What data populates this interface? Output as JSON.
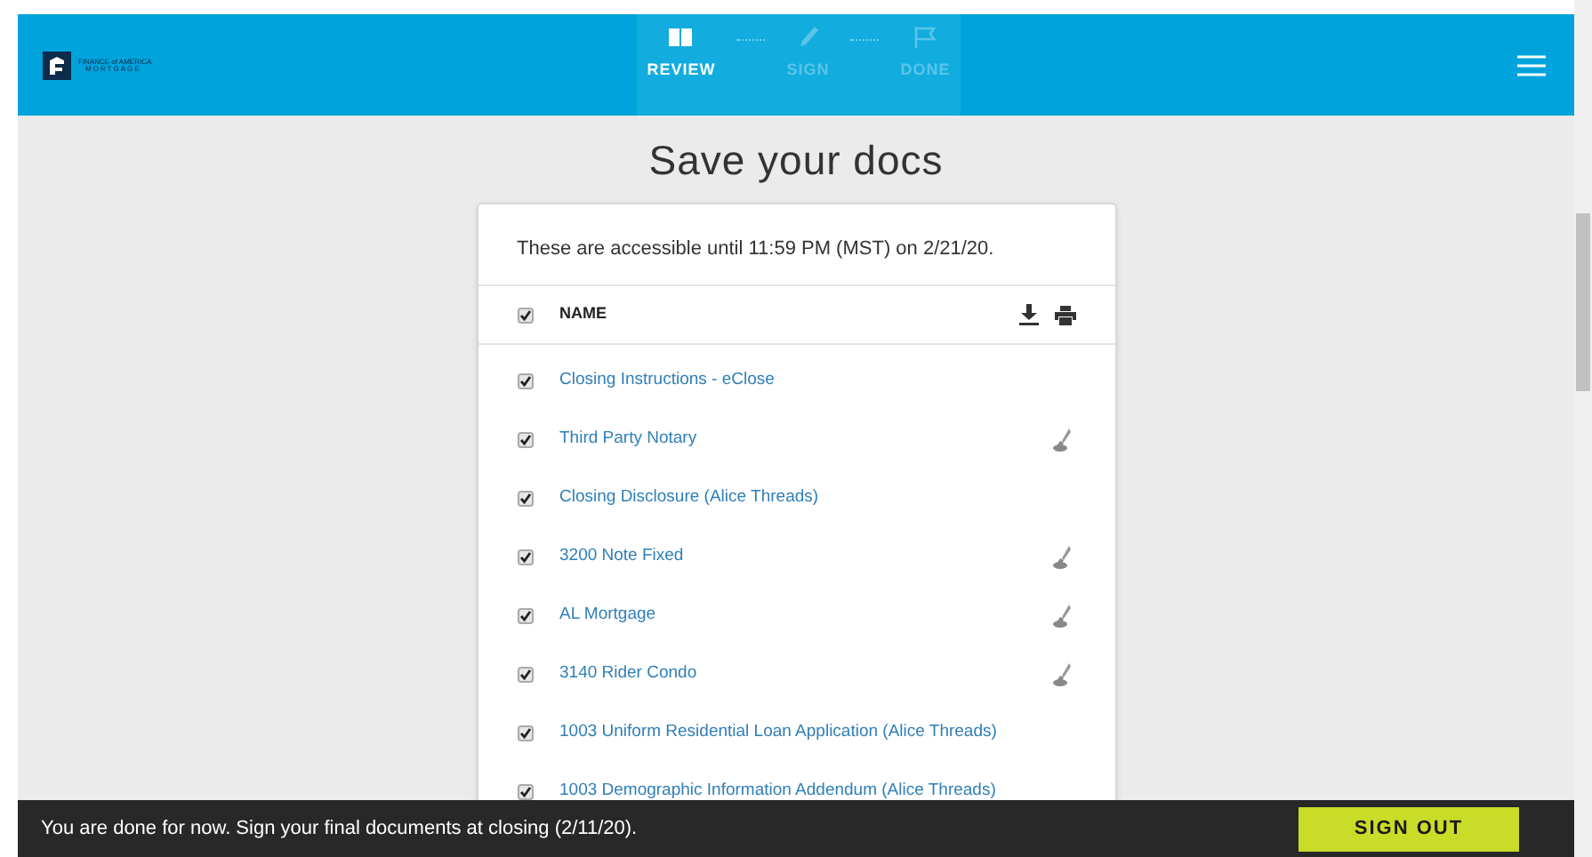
{
  "header": {
    "logo_line_1": "FINANCE of AMERICA",
    "logo_line_2": "MORTGAGE",
    "steps": [
      {
        "label": "REVIEW",
        "kind": "book",
        "selected": true
      },
      {
        "label": "SIGN",
        "kind": "pen",
        "selected": false
      },
      {
        "label": "DONE",
        "kind": "flag",
        "selected": false
      }
    ]
  },
  "title": "Save your docs",
  "card": {
    "note": "These are accessible until 11:59 PM (MST) on 2/21/20.",
    "header": {
      "checked": true,
      "name_column": "NAME"
    },
    "documents": [
      {
        "name": "Closing Instructions - eClose",
        "checked": true,
        "signable": false
      },
      {
        "name": "Third Party Notary",
        "checked": true,
        "signable": true
      },
      {
        "name": "Closing Disclosure (Alice Threads)",
        "checked": true,
        "signable": false
      },
      {
        "name": "3200 Note Fixed",
        "checked": true,
        "signable": true
      },
      {
        "name": "AL Mortgage",
        "checked": true,
        "signable": true
      },
      {
        "name": "3140 Rider Condo",
        "checked": true,
        "signable": true
      },
      {
        "name": "1003 Uniform Residential Loan Application (Alice Threads)",
        "checked": true,
        "signable": false
      },
      {
        "name": "1003 Demographic Information Addendum (Alice Threads)",
        "checked": true,
        "signable": false
      }
    ]
  },
  "footer": {
    "message": "You are done for now. Sign your final documents at closing (2/11/20).",
    "button": "SIGN OUT"
  }
}
